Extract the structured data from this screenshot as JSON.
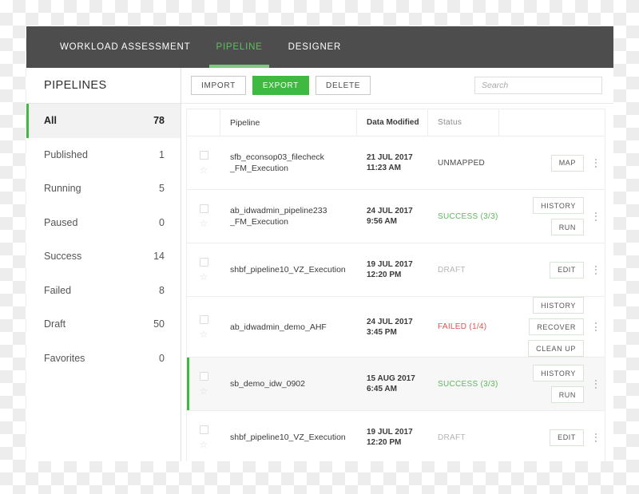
{
  "nav": {
    "tabs": [
      {
        "label": "WORKLOAD ASSESSMENT",
        "active": false
      },
      {
        "label": "PIPELINE",
        "active": true
      },
      {
        "label": "DESIGNER",
        "active": false
      }
    ]
  },
  "sidebar": {
    "title": "PIPELINES",
    "items": [
      {
        "label": "All",
        "count": "78",
        "active": true
      },
      {
        "label": "Published",
        "count": "1",
        "active": false
      },
      {
        "label": "Running",
        "count": "5",
        "active": false
      },
      {
        "label": "Paused",
        "count": "0",
        "active": false
      },
      {
        "label": "Success",
        "count": "14",
        "active": false
      },
      {
        "label": "Failed",
        "count": "8",
        "active": false
      },
      {
        "label": "Draft",
        "count": "50",
        "active": false
      },
      {
        "label": "Favorites",
        "count": "0",
        "active": false
      }
    ]
  },
  "toolbar": {
    "import_label": "IMPORT",
    "export_label": "EXPORT",
    "delete_label": "DELETE",
    "search_placeholder": "Search",
    "search_value": ""
  },
  "table": {
    "columns": [
      "",
      "Pipeline",
      "Data Modified",
      "Status",
      ""
    ],
    "rows": [
      {
        "name": "sfb_econsop03_filecheck\n_FM_Execution",
        "date": "21 JUL 2017",
        "time": "11:23 AM",
        "status": "UNMAPPED",
        "status_kind": "unmapped",
        "actions": [
          "MAP"
        ],
        "highlight": false
      },
      {
        "name": "ab_idwadmin_pipeline233\n_FM_Execution",
        "date": "24 JUL 2017",
        "time": "9:56 AM",
        "status": "SUCCESS (3/3)",
        "status_kind": "success",
        "actions": [
          "HISTORY",
          "RUN"
        ],
        "highlight": false
      },
      {
        "name": "shbf_pipeline10_VZ_Execution",
        "date": "19 JUL 2017",
        "time": "12:20 PM",
        "status": "DRAFT",
        "status_kind": "draft",
        "actions": [
          "EDIT"
        ],
        "highlight": false
      },
      {
        "name": "ab_idwadmin_demo_AHF",
        "date": "24 JUL 2017",
        "time": "3:45 PM",
        "status": "FAILED (1/4)",
        "status_kind": "failed",
        "actions": [
          "HISTORY",
          "RECOVER",
          "CLEAN UP"
        ],
        "highlight": false
      },
      {
        "name": "sb_demo_idw_0902",
        "date": "15 AUG 2017",
        "time": "6:45 AM",
        "status": "SUCCESS (3/3)",
        "status_kind": "success",
        "actions": [
          "HISTORY",
          "RUN"
        ],
        "highlight": true
      },
      {
        "name": "shbf_pipeline10_VZ_Execution",
        "date": "19 JUL 2017",
        "time": "12:20 PM",
        "status": "DRAFT",
        "status_kind": "draft",
        "actions": [
          "EDIT"
        ],
        "highlight": false
      }
    ],
    "row_icons": {
      "checkbox": "checkbox-icon",
      "star": "star-icon",
      "overflow": "kebab-menu-icon"
    }
  },
  "colors": {
    "accent_green": "#3fb93f",
    "nav_bar": "#4d4d4d",
    "success": "#5cb85c",
    "failed": "#e05252",
    "draft": "#b5b5b5"
  }
}
